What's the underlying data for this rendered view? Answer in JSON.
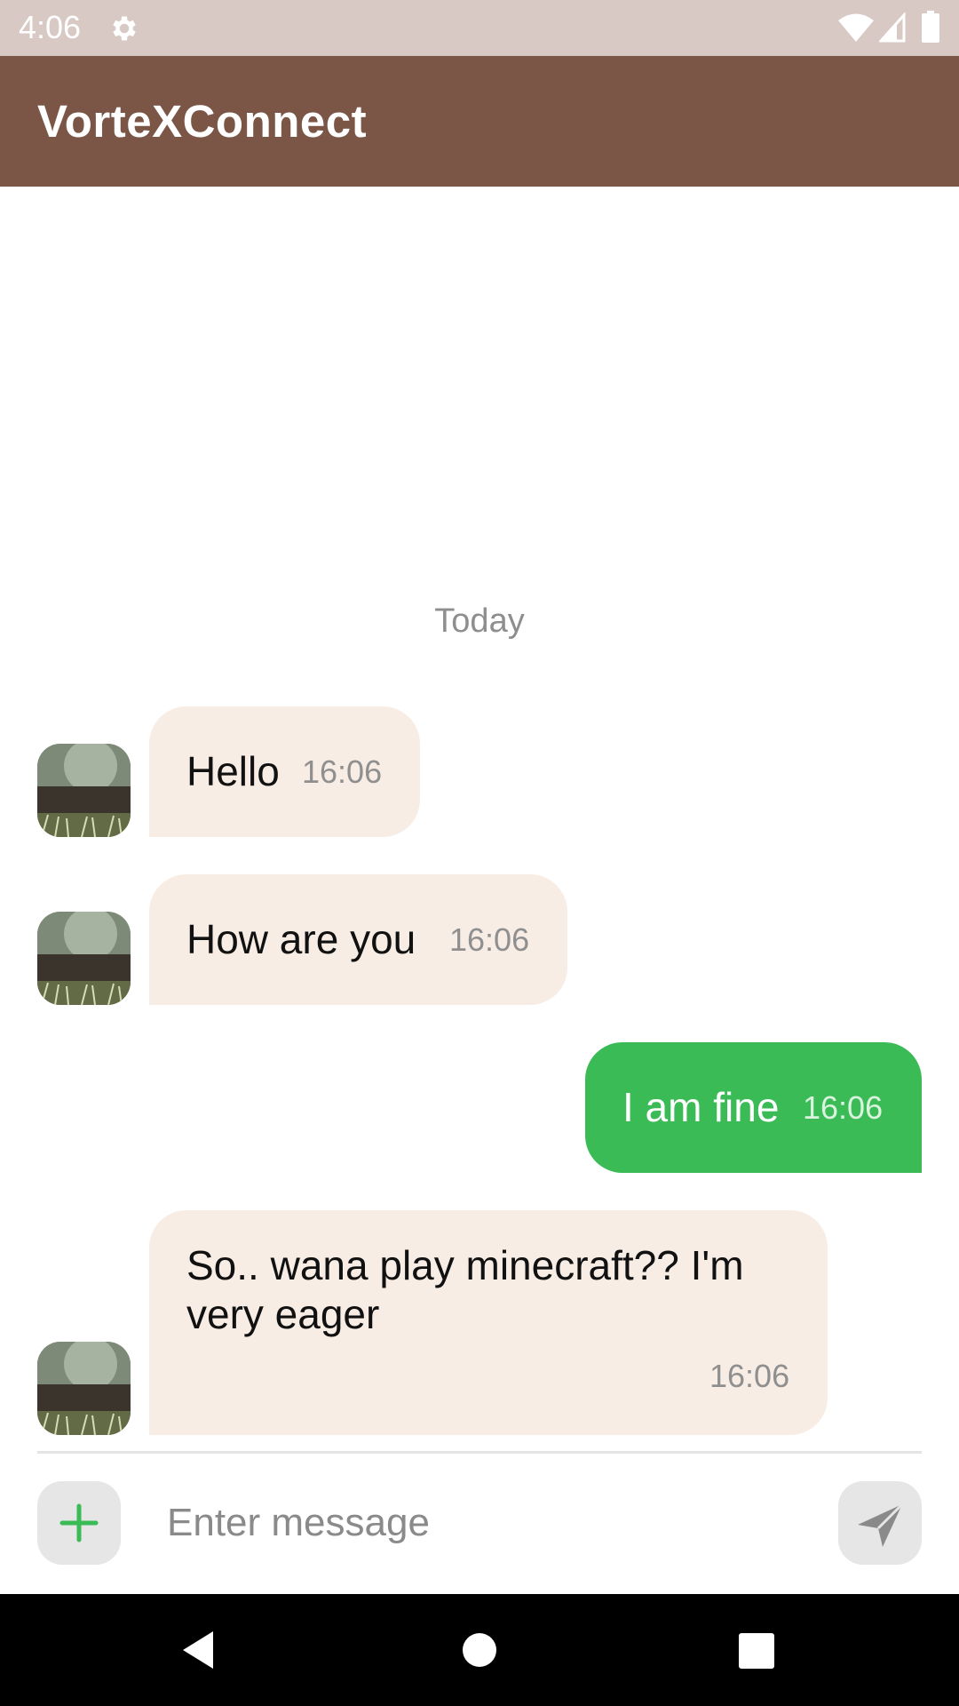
{
  "status_bar": {
    "time": "4:06",
    "icons": [
      "settings-icon",
      "wifi-icon",
      "cell-signal-icon",
      "battery-icon"
    ]
  },
  "app_bar": {
    "title": "VorteXConnect",
    "color": "#7b5647"
  },
  "chat": {
    "date_separator": "Today",
    "messages": [
      {
        "direction": "incoming",
        "text": "Hello",
        "time": "16:06"
      },
      {
        "direction": "incoming",
        "text": "How are you",
        "time": "16:06"
      },
      {
        "direction": "outgoing",
        "text": "I am fine",
        "time": "16:06"
      },
      {
        "direction": "incoming",
        "text_line1": "So.. wana play minecraft?? I'm",
        "text_line2": "very eager",
        "time": "16:06"
      }
    ],
    "incoming_bubble_color": "#f7ede5",
    "outgoing_bubble_color": "#3abb56"
  },
  "composer": {
    "placeholder": "Enter message",
    "value": "",
    "add_icon": "plus-icon",
    "send_icon": "send-icon",
    "accent": "#3abb56"
  },
  "nav_bar": {
    "icons": [
      "back-icon",
      "home-icon",
      "recents-icon"
    ]
  }
}
